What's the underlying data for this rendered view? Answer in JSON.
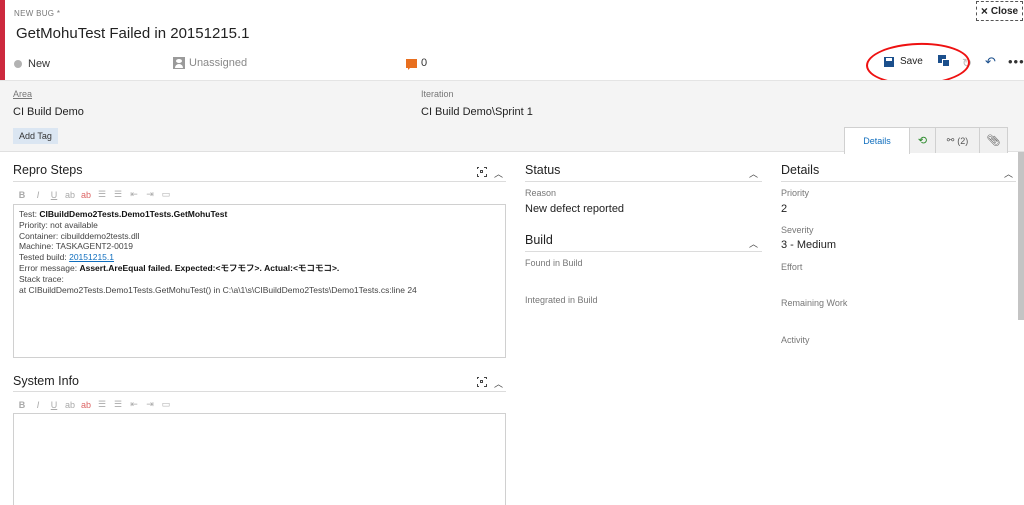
{
  "header": {
    "kind": "NEW BUG *",
    "title": "GetMohuTest Failed in 20151215.1",
    "close_label": "Close",
    "state": "New",
    "assigned": "Unassigned",
    "comment_count": "0",
    "save_label": "Save"
  },
  "fields": {
    "area_label": "Area",
    "area_value": "CI Build Demo",
    "iteration_label": "Iteration",
    "iteration_value": "CI Build Demo\\Sprint 1",
    "add_tag": "Add Tag"
  },
  "tabs": {
    "details": "Details",
    "links": "(2)"
  },
  "repro": {
    "title": "Repro Steps",
    "line1_prefix": "Test: ",
    "line1_value": "CIBuildDemo2Tests.Demo1Tests.GetMohuTest",
    "line2": "Priority: not available",
    "line3": "Container: cibuilddemo2tests.dll",
    "line4": "Machine: TASKAGENT2-0019",
    "line5_prefix": "Tested build: ",
    "line5_link": "20151215.1",
    "line6_prefix": "Error message: ",
    "line6_value": "Assert.AreEqual failed. Expected:<モフモフ>. Actual:<モコモコ>.",
    "line7": "Stack trace:",
    "line8": "at CIBuildDemo2Tests.Demo1Tests.GetMohuTest() in C:\\a\\1\\s\\CIBuildDemo2Tests\\Demo1Tests.cs:line 24"
  },
  "system_info": {
    "title": "System Info"
  },
  "status": {
    "title": "Status",
    "reason_label": "Reason",
    "reason_value": "New defect reported"
  },
  "build": {
    "title": "Build",
    "found_label": "Found in Build",
    "integrated_label": "Integrated in Build"
  },
  "details": {
    "title": "Details",
    "priority_label": "Priority",
    "priority_value": "2",
    "severity_label": "Severity",
    "severity_value": "3 - Medium",
    "effort_label": "Effort",
    "remaining_label": "Remaining Work",
    "activity_label": "Activity"
  },
  "format_buttons": [
    "B",
    "I",
    "U",
    "ab",
    "ab",
    "☰",
    "☰",
    "⇤",
    "⇥",
    "▭"
  ],
  "colors": {
    "bug_red": "#cc293d",
    "accent_blue": "#106ebe",
    "comment_orange": "#e86f1f",
    "annotation_red": "#ee1111"
  }
}
